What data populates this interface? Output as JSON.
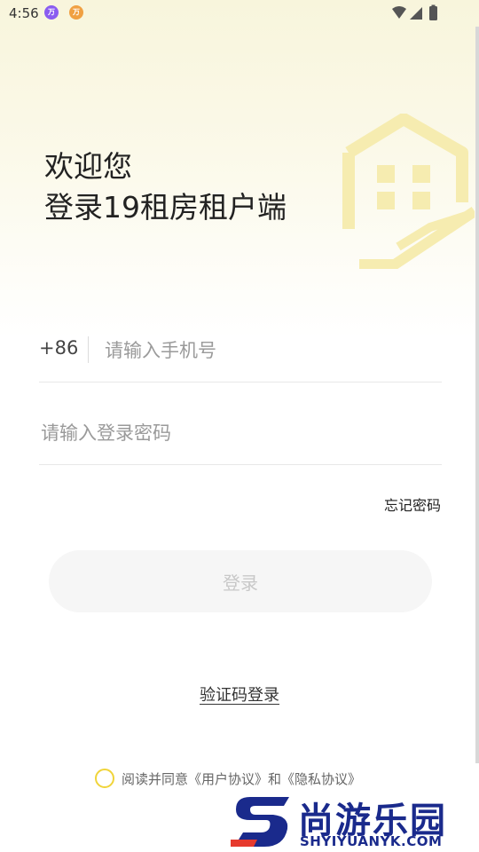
{
  "status_bar": {
    "time": "4:56",
    "notifications": [
      "万",
      "万"
    ]
  },
  "header": {
    "welcome_line1": "欢迎您",
    "welcome_line2": "登录19租房租户端"
  },
  "form": {
    "country_code": "+86",
    "phone_placeholder": "请输入手机号",
    "password_placeholder": "请输入登录密码",
    "forgot_password": "忘记密码",
    "login_button": "登录",
    "sms_login": "验证码登录"
  },
  "agreement": {
    "text": "阅读并同意《用户协议》和《隐私协议》"
  },
  "watermark": {
    "title": "尚游乐园",
    "url": "SHYIYUANYK.COM"
  },
  "colors": {
    "accent": "#f0d43a",
    "brand_watermark": "#1a2a8c"
  }
}
